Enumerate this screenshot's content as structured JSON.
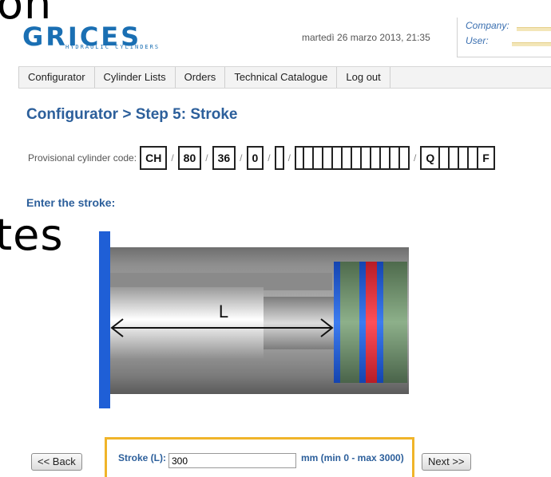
{
  "overlay": {
    "top_text": "on",
    "middle_text": "tes"
  },
  "header": {
    "logo": "GRICES",
    "logo_tagline": "HYDRAULIC CYLINDERS",
    "date": "martedì 26 marzo 2013, 21:35",
    "company_label": "Company:",
    "user_label": "User:"
  },
  "nav": [
    "Configurator",
    "Cylinder Lists",
    "Orders",
    "Technical Catalogue",
    "Log out"
  ],
  "page_title": "Configurator > Step 5: Stroke",
  "code": {
    "label": "Provisional cylinder code:",
    "parts": [
      "CH",
      "80",
      "36",
      "0",
      "",
      "",
      "Q",
      "F"
    ]
  },
  "subtitle": "Enter the stroke:",
  "diagram": {
    "dimension_label": "L"
  },
  "form": {
    "back_label": "<< Back",
    "stroke_label": "Stroke (L):",
    "stroke_value": "300",
    "range_text": "mm (min 0 - max 3000)",
    "next_label": "Next >>"
  },
  "colors": {
    "accent": "#2c5f9b",
    "panel_border": "#f0b429",
    "rod_blue": "#1f5fd6",
    "seal_red": "#e8343c",
    "seal_green": "#6f8f6c"
  }
}
